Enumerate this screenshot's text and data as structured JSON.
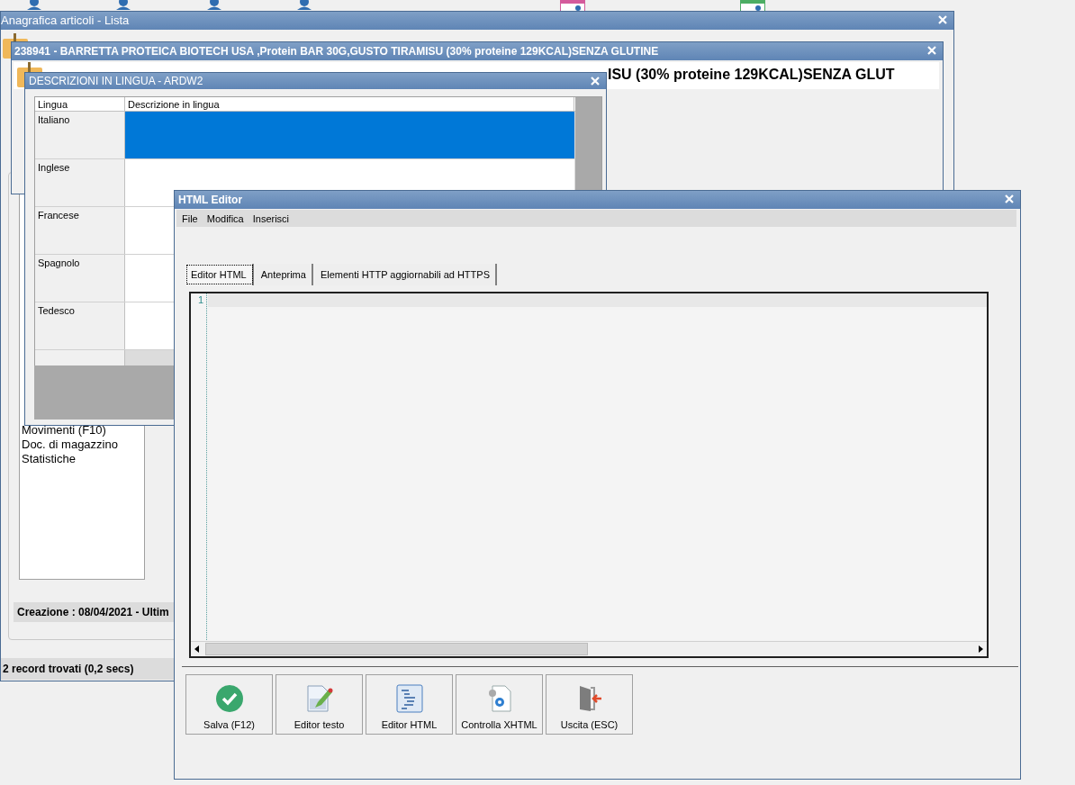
{
  "list_window": {
    "title": "Anagrafica articoli  - Lista",
    "side_list": [
      {
        "label": "Movimenti (F10)"
      },
      {
        "label": "Doc. di magazzino"
      },
      {
        "label": "Statistiche"
      }
    ],
    "info_bar": "Creazione : 08/04/2021 - Ultim",
    "status_bar": "2 record trovati (0,2 secs)"
  },
  "article_window": {
    "title": "238941 - BARRETTA PROTEICA BIOTECH USA ,Protein BAR 30G,GUSTO TIRAMISU  (30% proteine 129KCAL)SENZA GLUTINE",
    "heading": "ISU  (30% proteine 129KCAL)SENZA GLUT"
  },
  "languages_window": {
    "title": "DESCRIZIONI IN LINGUA - ARDW2",
    "columns": [
      "Lingua",
      "Descrizione in lingua"
    ],
    "rows": [
      {
        "language": "Italiano",
        "selected": true
      },
      {
        "language": "Inglese",
        "selected": false
      },
      {
        "language": "Francese",
        "selected": false
      },
      {
        "language": "Spagnolo",
        "selected": false
      },
      {
        "language": "Tedesco",
        "selected": false
      }
    ]
  },
  "html_editor": {
    "title": "HTML Editor",
    "menu": [
      "File",
      "Modifica",
      "Inserisci"
    ],
    "tabs": [
      {
        "label": "Editor HTML",
        "selected": true
      },
      {
        "label": "Anteprima",
        "selected": false
      },
      {
        "label": "Elementi HTTP aggiornabili ad HTTPS",
        "selected": false
      }
    ],
    "line_numbers": [
      "1"
    ],
    "buttons": [
      {
        "kind": "save",
        "label": "Salva (F12)"
      },
      {
        "kind": "text",
        "label": "Editor testo"
      },
      {
        "kind": "html",
        "label": "Editor HTML"
      },
      {
        "kind": "check",
        "label": "Controlla XHTML"
      },
      {
        "kind": "exit",
        "label": "Uscita (ESC)"
      }
    ]
  }
}
